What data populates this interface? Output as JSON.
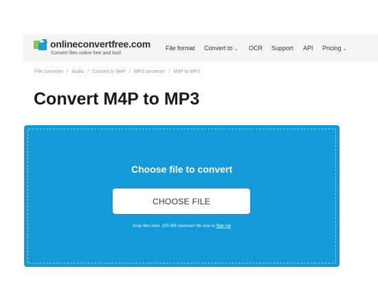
{
  "header": {
    "brand": "onlineconvertfree.com",
    "tagline": "Convert files online free and fast!",
    "nav": {
      "file_format": "File format",
      "convert_to": "Convert to",
      "ocr": "OCR",
      "support": "Support",
      "api": "API",
      "pricing": "Pricing"
    },
    "logo_colors": [
      "#8cc63f",
      "#1e9bd7"
    ]
  },
  "breadcrumb": [
    "File converter",
    "Audio",
    "Convert to M4P",
    "MP3 converter",
    "M4P to MP3"
  ],
  "title": "Convert M4P to MP3",
  "dropzone": {
    "heading": "Choose file to convert",
    "button_label": "CHOOSE FILE",
    "note_text": "Drop files here. 100 MB maximum file size or",
    "signup_link": "Sign Up",
    "color": "#159ad9"
  }
}
